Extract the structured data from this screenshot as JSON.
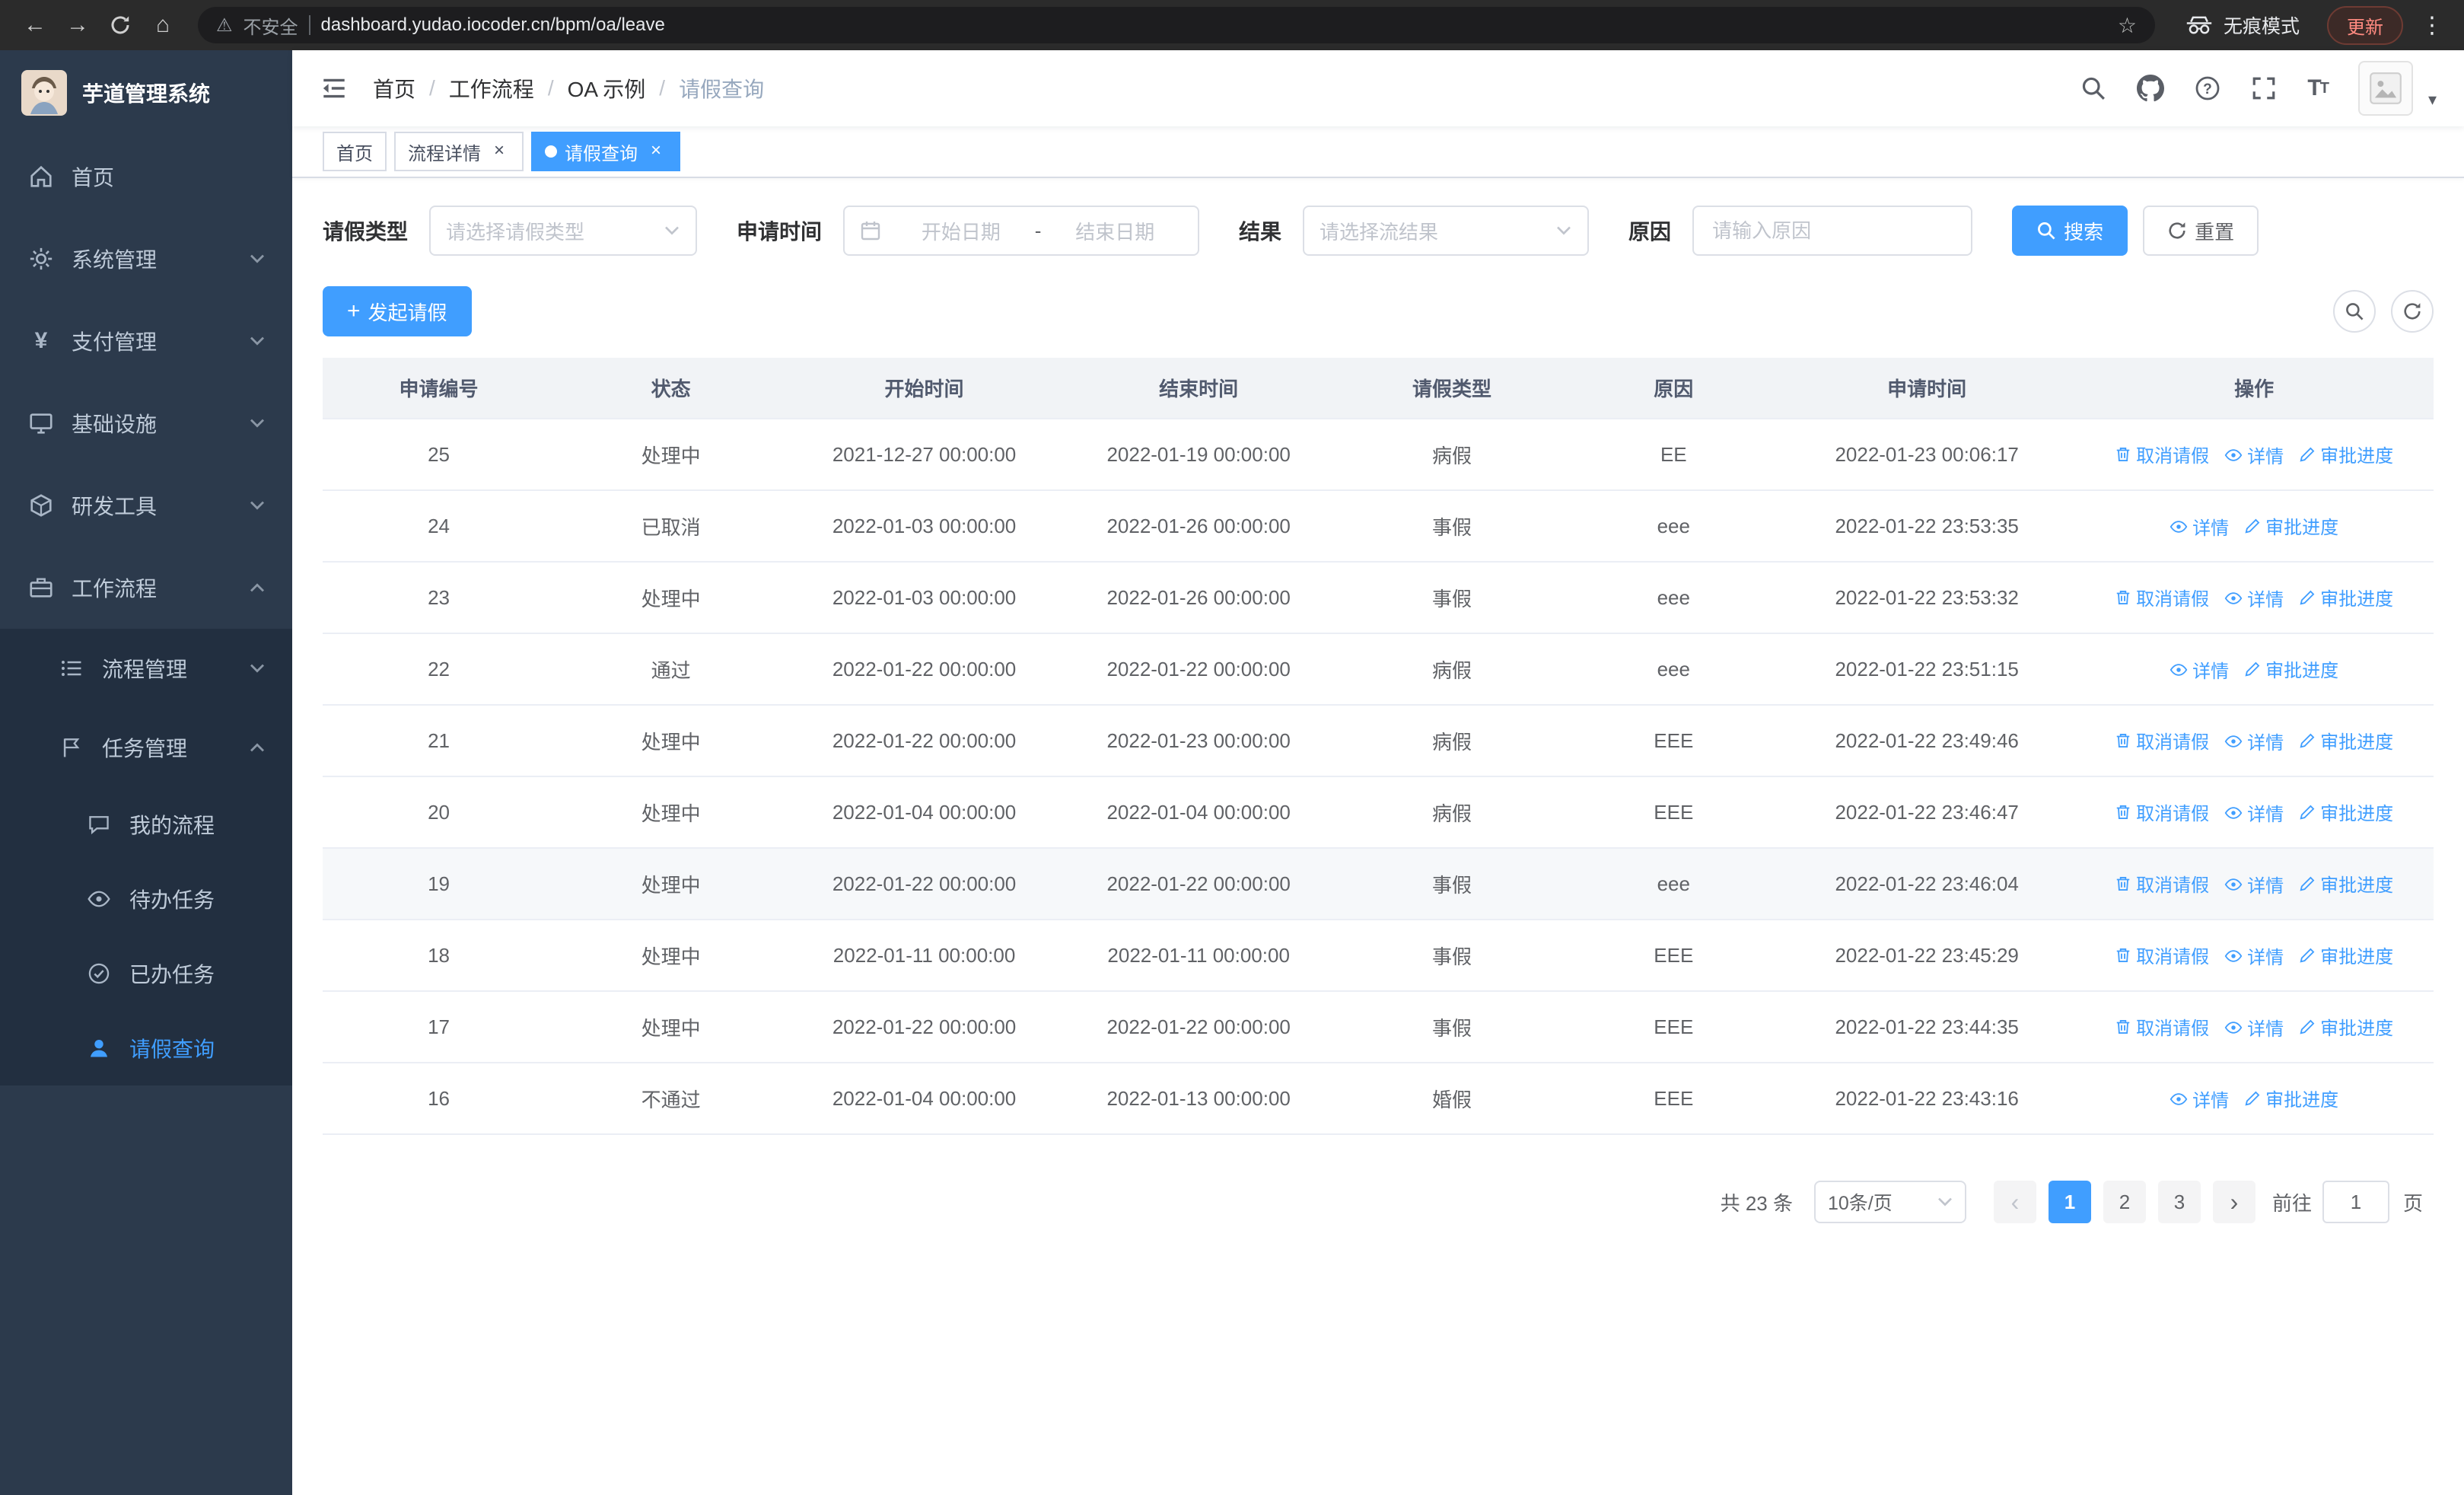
{
  "colors": {
    "accent": "#409eff",
    "sidebar_bg": "#2c3a4c",
    "submenu_bg": "#222f40"
  },
  "browser": {
    "security_label": "不安全",
    "url": "dashboard.yudao.iocoder.cn/bpm/oa/leave",
    "incognito_label": "无痕模式",
    "update_label": "更新"
  },
  "sidebar": {
    "app_title": "芋道管理系统",
    "items": [
      {
        "label": "首页"
      },
      {
        "label": "系统管理"
      },
      {
        "label": "支付管理"
      },
      {
        "label": "基础设施"
      },
      {
        "label": "研发工具"
      },
      {
        "label": "工作流程"
      }
    ],
    "workflow_submenu": [
      {
        "label": "流程管理"
      },
      {
        "label": "任务管理"
      }
    ],
    "task_submenu": [
      {
        "label": "我的流程"
      },
      {
        "label": "待办任务"
      },
      {
        "label": "已办任务"
      },
      {
        "label": "请假查询"
      }
    ]
  },
  "breadcrumb": [
    "首页",
    "工作流程",
    "OA 示例",
    "请假查询"
  ],
  "tabs": [
    {
      "label": "首页"
    },
    {
      "label": "流程详情"
    },
    {
      "label": "请假查询"
    }
  ],
  "filters": {
    "leave_type_label": "请假类型",
    "leave_type_placeholder": "请选择请假类型",
    "apply_time_label": "申请时间",
    "start_placeholder": "开始日期",
    "range_separator": "-",
    "end_placeholder": "结束日期",
    "result_label": "结果",
    "result_placeholder": "请选择流结果",
    "reason_label": "原因",
    "reason_placeholder": "请输入原因",
    "search_label": "搜索",
    "reset_label": "重置"
  },
  "toolbar": {
    "create_label": "发起请假"
  },
  "table": {
    "columns": [
      "申请编号",
      "状态",
      "开始时间",
      "结束时间",
      "请假类型",
      "原因",
      "申请时间",
      "操作"
    ],
    "action_labels": {
      "cancel": "取消请假",
      "detail": "详情",
      "progress": "审批进度"
    },
    "rows": [
      {
        "id": "25",
        "status": "处理中",
        "start": "2021-12-27 00:00:00",
        "end": "2022-01-19 00:00:00",
        "type": "病假",
        "reason": "EE",
        "apply_time": "2022-01-23 00:06:17",
        "actions": [
          "cancel",
          "detail",
          "progress"
        ],
        "highlighted": false
      },
      {
        "id": "24",
        "status": "已取消",
        "start": "2022-01-03 00:00:00",
        "end": "2022-01-26 00:00:00",
        "type": "事假",
        "reason": "eee",
        "apply_time": "2022-01-22 23:53:35",
        "actions": [
          "detail",
          "progress"
        ],
        "highlighted": false
      },
      {
        "id": "23",
        "status": "处理中",
        "start": "2022-01-03 00:00:00",
        "end": "2022-01-26 00:00:00",
        "type": "事假",
        "reason": "eee",
        "apply_time": "2022-01-22 23:53:32",
        "actions": [
          "cancel",
          "detail",
          "progress"
        ],
        "highlighted": false
      },
      {
        "id": "22",
        "status": "通过",
        "start": "2022-01-22 00:00:00",
        "end": "2022-01-22 00:00:00",
        "type": "病假",
        "reason": "eee",
        "apply_time": "2022-01-22 23:51:15",
        "actions": [
          "detail",
          "progress"
        ],
        "highlighted": false
      },
      {
        "id": "21",
        "status": "处理中",
        "start": "2022-01-22 00:00:00",
        "end": "2022-01-23 00:00:00",
        "type": "病假",
        "reason": "EEE",
        "apply_time": "2022-01-22 23:49:46",
        "actions": [
          "cancel",
          "detail",
          "progress"
        ],
        "highlighted": false
      },
      {
        "id": "20",
        "status": "处理中",
        "start": "2022-01-04 00:00:00",
        "end": "2022-01-04 00:00:00",
        "type": "病假",
        "reason": "EEE",
        "apply_time": "2022-01-22 23:46:47",
        "actions": [
          "cancel",
          "detail",
          "progress"
        ],
        "highlighted": false
      },
      {
        "id": "19",
        "status": "处理中",
        "start": "2022-01-22 00:00:00",
        "end": "2022-01-22 00:00:00",
        "type": "事假",
        "reason": "eee",
        "apply_time": "2022-01-22 23:46:04",
        "actions": [
          "cancel",
          "detail",
          "progress"
        ],
        "highlighted": true
      },
      {
        "id": "18",
        "status": "处理中",
        "start": "2022-01-11 00:00:00",
        "end": "2022-01-11 00:00:00",
        "type": "事假",
        "reason": "EEE",
        "apply_time": "2022-01-22 23:45:29",
        "actions": [
          "cancel",
          "detail",
          "progress"
        ],
        "highlighted": false
      },
      {
        "id": "17",
        "status": "处理中",
        "start": "2022-01-22 00:00:00",
        "end": "2022-01-22 00:00:00",
        "type": "事假",
        "reason": "EEE",
        "apply_time": "2022-01-22 23:44:35",
        "actions": [
          "cancel",
          "detail",
          "progress"
        ],
        "highlighted": false
      },
      {
        "id": "16",
        "status": "不通过",
        "start": "2022-01-04 00:00:00",
        "end": "2022-01-13 00:00:00",
        "type": "婚假",
        "reason": "EEE",
        "apply_time": "2022-01-22 23:43:16",
        "actions": [
          "detail",
          "progress"
        ],
        "highlighted": false
      }
    ]
  },
  "pagination": {
    "total_label": "共 23 条",
    "page_size_label": "10条/页",
    "pages": [
      "1",
      "2",
      "3"
    ],
    "active_page": "1",
    "goto_label": "前往",
    "goto_value": "1",
    "unit_label": "页"
  }
}
